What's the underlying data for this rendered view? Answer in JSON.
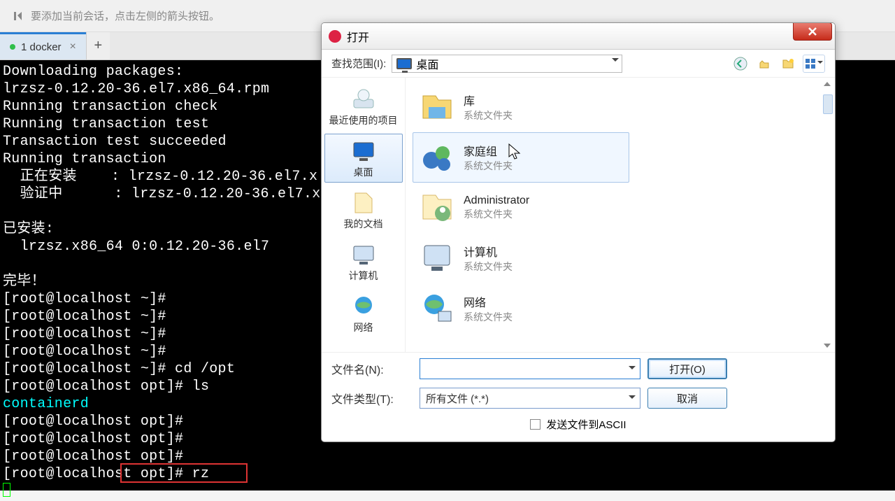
{
  "topbar": {
    "hint": "要添加当前会话，点击左侧的箭头按钮。"
  },
  "tabs": {
    "active": "1 docker",
    "close_glyph": "×",
    "add_glyph": "+"
  },
  "terminal": {
    "lines": [
      "Downloading packages:",
      "lrzsz-0.12.20-36.el7.x86_64.rpm",
      "Running transaction check",
      "Running transaction test",
      "Transaction test succeeded",
      "Running transaction",
      "  正在安装    : lrzsz-0.12.20-36.el7.x",
      "  验证中      : lrzsz-0.12.20-36.el7.x",
      "",
      "已安装:",
      "  lrzsz.x86_64 0:0.12.20-36.el7",
      "",
      "完毕！",
      "[root@localhost ~]#",
      "[root@localhost ~]#",
      "[root@localhost ~]#",
      "[root@localhost ~]#",
      "[root@localhost ~]# cd /opt",
      "[root@localhost opt]# ls"
    ],
    "dir_entry": "containerd",
    "post_ls": [
      "[root@localhost opt]#",
      "[root@localhost opt]#",
      "[root@localhost opt]#",
      "[root@localhost opt]# rz"
    ]
  },
  "dialog": {
    "title": "打开",
    "lookin_label": "查找范围(I):",
    "lookin_value": "桌面",
    "places": [
      {
        "label": "最近使用的项目"
      },
      {
        "label": "桌面"
      },
      {
        "label": "我的文档"
      },
      {
        "label": "计算机"
      },
      {
        "label": "网络"
      }
    ],
    "files": [
      {
        "name": "库",
        "sub": "系统文件夹"
      },
      {
        "name": "家庭组",
        "sub": "系统文件夹"
      },
      {
        "name": "Administrator",
        "sub": "系统文件夹"
      },
      {
        "name": "计算机",
        "sub": "系统文件夹"
      },
      {
        "name": "网络",
        "sub": "系统文件夹"
      }
    ],
    "filename_label": "文件名(N):",
    "filetype_label": "文件类型(T):",
    "filetype_value": "所有文件 (*.*)",
    "open_btn": "打开(O)",
    "cancel_btn": "取消",
    "ascii_chk": "发送文件到ASCII"
  }
}
